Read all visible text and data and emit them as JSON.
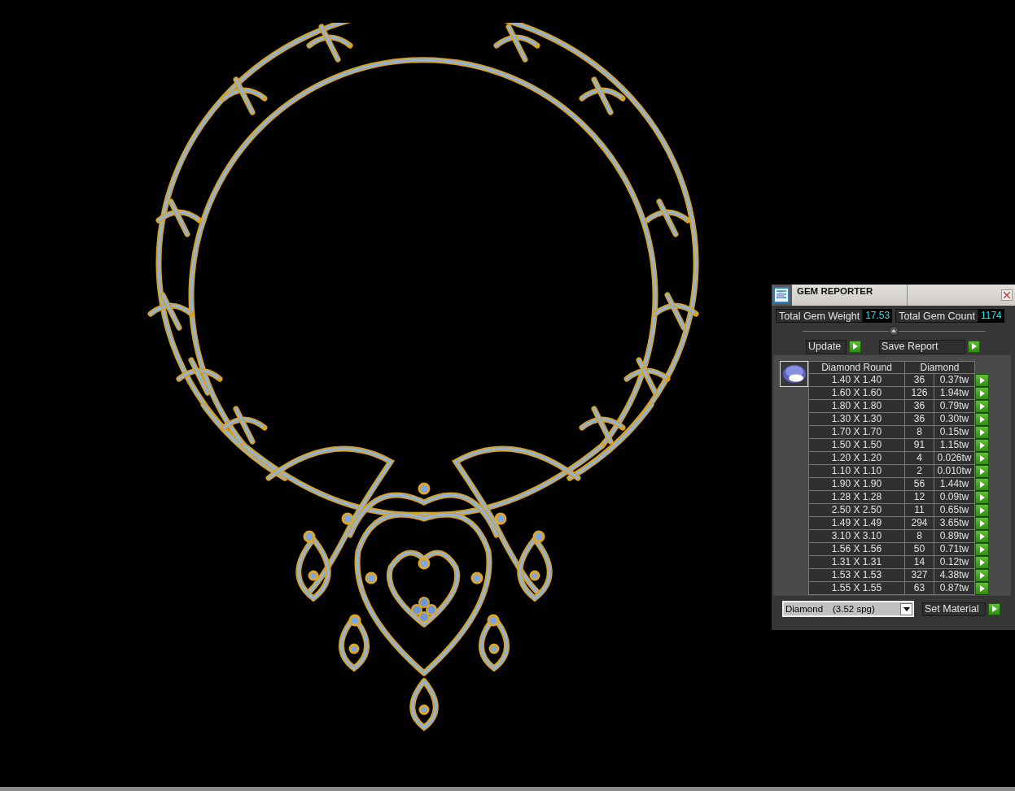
{
  "window": {
    "title": "GEM REPORTER"
  },
  "totals": [
    {
      "label": "Total Gem Weight",
      "value": "17.53"
    },
    {
      "label": "Total Gem Count",
      "value": "1174"
    }
  ],
  "actions": [
    "Update",
    "Save Report"
  ],
  "table": {
    "columns": [
      "Diamond Round",
      "Diamond"
    ],
    "rows": [
      {
        "size": "1.40 X 1.40",
        "count": "36",
        "weight": "0.37tw"
      },
      {
        "size": "1.60 X 1.60",
        "count": "126",
        "weight": "1.94tw"
      },
      {
        "size": "1.80 X 1.80",
        "count": "36",
        "weight": "0.79tw"
      },
      {
        "size": "1.30 X 1.30",
        "count": "36",
        "weight": "0.30tw"
      },
      {
        "size": "1.70 X 1.70",
        "count": "8",
        "weight": "0.15tw"
      },
      {
        "size": "1.50 X 1.50",
        "count": "91",
        "weight": "1.15tw"
      },
      {
        "size": "1.20 X 1.20",
        "count": "4",
        "weight": "0.026tw"
      },
      {
        "size": "1.10 X 1.10",
        "count": "2",
        "weight": "0.010tw"
      },
      {
        "size": "1.90 X 1.90",
        "count": "56",
        "weight": "1.44tw"
      },
      {
        "size": "1.28 X 1.28",
        "count": "12",
        "weight": "0.09tw"
      },
      {
        "size": "2.50 X 2.50",
        "count": "11",
        "weight": "0.65tw"
      },
      {
        "size": "1.49 X 1.49",
        "count": "294",
        "weight": "3.65tw"
      },
      {
        "size": "3.10 X 3.10",
        "count": "8",
        "weight": "0.89tw"
      },
      {
        "size": "1.56 X 1.56",
        "count": "50",
        "weight": "0.71tw"
      },
      {
        "size": "1.31 X 1.31",
        "count": "14",
        "weight": "0.12tw"
      },
      {
        "size": "1.53 X 1.53",
        "count": "327",
        "weight": "4.38tw"
      },
      {
        "size": "1.55 X 1.55",
        "count": "63",
        "weight": "0.87tw"
      }
    ]
  },
  "material": {
    "name": "Diamond",
    "density": "(3.52 spg)"
  },
  "set_material": "Set Material"
}
